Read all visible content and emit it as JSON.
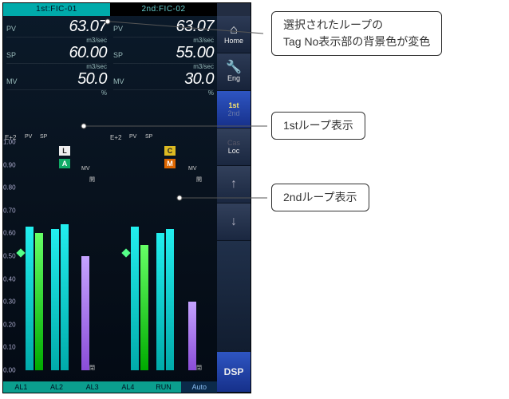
{
  "tags": {
    "first": "1st:FIC-01",
    "second": "2nd:FIC-02"
  },
  "loops": [
    {
      "pv": {
        "label": "PV",
        "value": "63.07",
        "unit": "m3/sec"
      },
      "sp": {
        "label": "SP",
        "value": "60.00",
        "unit": "m3/sec"
      },
      "mv": {
        "label": "MV",
        "value": "50.0",
        "unit": "%"
      },
      "flags": [
        "L",
        "A"
      ],
      "scale_label": "E+2"
    },
    {
      "pv": {
        "label": "PV",
        "value": "63.07",
        "unit": "m3/sec"
      },
      "sp": {
        "label": "SP",
        "value": "55.00",
        "unit": "m3/sec"
      },
      "mv": {
        "label": "MV",
        "value": "30.0",
        "unit": "%"
      },
      "flags": [
        "C",
        "M"
      ],
      "scale_label": "E+2"
    }
  ],
  "scale": [
    "1.00",
    "0.90",
    "0.80",
    "0.70",
    "0.60",
    "0.50",
    "0.40",
    "0.30",
    "0.20",
    "0.10",
    "0.00"
  ],
  "axis_top": {
    "pv": "PV",
    "sp": "SP",
    "mv": "MV"
  },
  "mark_open": "開",
  "mark_close": "閉",
  "alarms": [
    "AL1",
    "AL2",
    "AL3",
    "AL4"
  ],
  "status": {
    "run": "RUN",
    "auto": "Auto"
  },
  "sidebar": {
    "home": "Home",
    "eng": "Eng",
    "first": "1st",
    "second": "2nd",
    "cas": "Cas",
    "loc": "Loc",
    "dsp": "DSP"
  },
  "callouts": {
    "c1_line1": "選択されたループの",
    "c1_line2": "Tag No表示部の背景色が変色",
    "c2": "1stループ表示",
    "c3": "2ndループ表示"
  },
  "chart_data": {
    "type": "bar",
    "loops": [
      {
        "name": "1st",
        "pv_scale": {
          "min": 0,
          "max": 1,
          "unit": "E+2"
        },
        "pv": 0.63,
        "sp": 0.6,
        "mv_percent": 50.0,
        "alarm_bars": [
          {
            "name": "AL1",
            "value": 0.62
          },
          {
            "name": "AL2",
            "value": 0.64
          }
        ]
      },
      {
        "name": "2nd",
        "pv_scale": {
          "min": 0,
          "max": 1,
          "unit": "E+2"
        },
        "pv": 0.63,
        "sp": 0.55,
        "mv_percent": 30.0,
        "alarm_bars": [
          {
            "name": "AL3",
            "value": 0.6
          },
          {
            "name": "AL4",
            "value": 0.62
          }
        ]
      }
    ]
  }
}
